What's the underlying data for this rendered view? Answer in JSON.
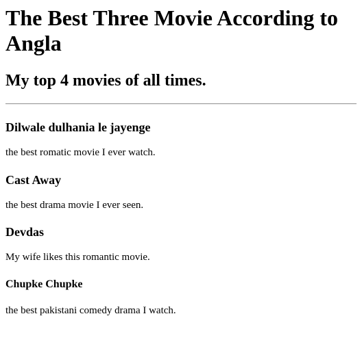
{
  "page": {
    "title": "The Best Three Movie According to Angla",
    "subtitle": "My top 4 movies of all times."
  },
  "movies": [
    {
      "name": "Dilwale dulhania le jayenge",
      "description": "the best romatic movie I ever watch."
    },
    {
      "name": "Cast Away",
      "description": "the best drama movie I ever seen."
    },
    {
      "name": "Devdas",
      "description": "My wife likes this romantic movie."
    },
    {
      "name": "Chupke Chupke",
      "description": "the best pakistani comedy drama I watch."
    }
  ]
}
